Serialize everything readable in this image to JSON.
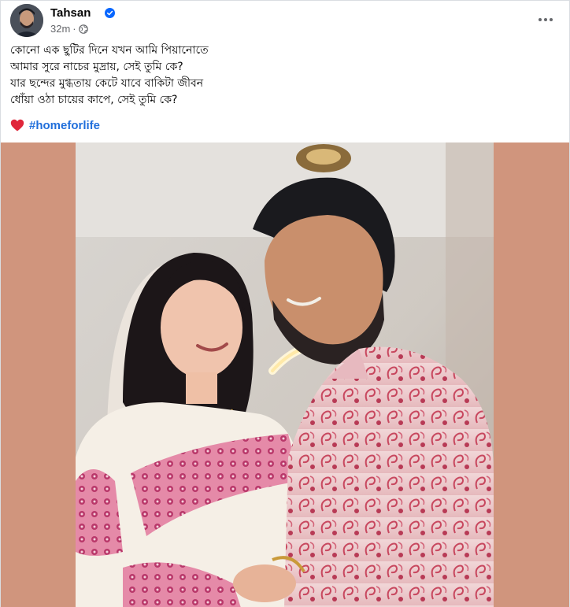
{
  "post": {
    "author": "Tahsan",
    "time": "32m",
    "separator": "·",
    "privacy_icon": "globe-icon",
    "verified_icon": "verified-badge-icon",
    "more_icon": "more-options-icon",
    "lines": [
      "কোনো এক ছুটির দিনে যখন আমি পিয়ানোতে",
      "আমার সুরে নাচের মুদ্রায়, সেই তুমি কে?",
      "যার ছন্দের মুগ্ধতায় কেটে যাবে বাকিটা জীবন",
      "ধোঁয়া ওঠা চায়ের কাপে, সেই তুমি কে?"
    ],
    "reaction_icon": "red-heart-icon",
    "hashtag": "#homeforlife"
  },
  "colors": {
    "accent_link": "#216fdb",
    "verified": "#0866ff",
    "media_background": "#d0957d",
    "secondary_text": "#65676b"
  }
}
